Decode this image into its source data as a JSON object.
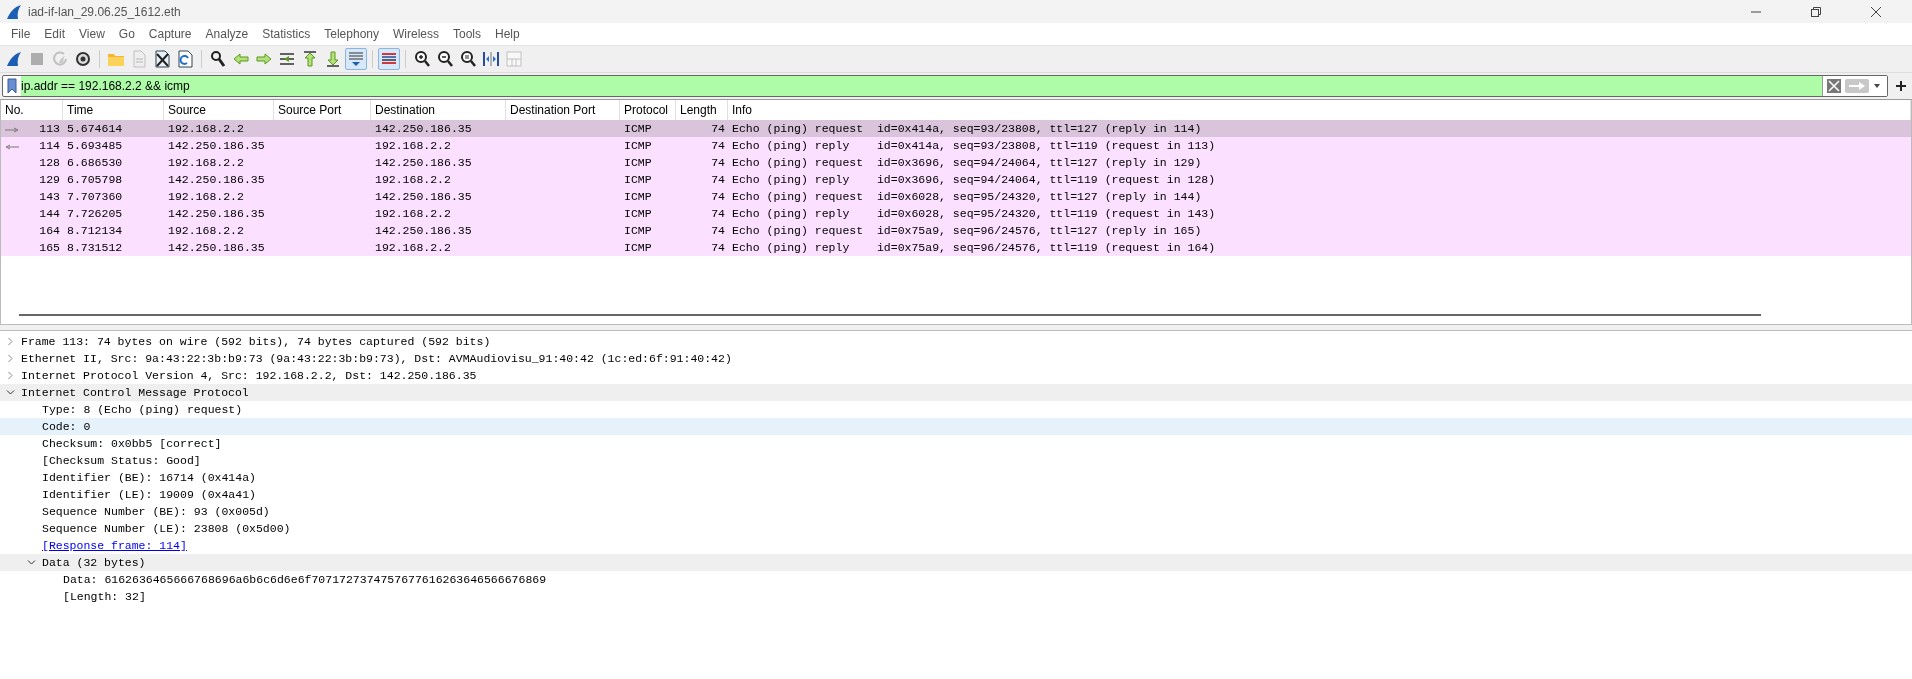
{
  "window": {
    "title": "iad-if-lan_29.06.25_1612.eth"
  },
  "menu": [
    "File",
    "Edit",
    "View",
    "Go",
    "Capture",
    "Analyze",
    "Statistics",
    "Telephony",
    "Wireless",
    "Tools",
    "Help"
  ],
  "toolbar": [
    [
      {
        "kind": "start",
        "on": false,
        "disabled": false
      },
      {
        "kind": "stop",
        "on": false,
        "disabled": true
      },
      {
        "kind": "restart",
        "on": false,
        "disabled": true
      },
      {
        "kind": "options",
        "on": false,
        "disabled": false
      }
    ],
    [
      {
        "kind": "open",
        "on": false,
        "disabled": false
      },
      {
        "kind": "save",
        "on": false,
        "disabled": true
      },
      {
        "kind": "close",
        "on": false,
        "disabled": false
      },
      {
        "kind": "reload",
        "on": false,
        "disabled": false
      }
    ],
    [
      {
        "kind": "find",
        "on": false,
        "disabled": false
      },
      {
        "kind": "back",
        "on": false,
        "disabled": false
      },
      {
        "kind": "forward",
        "on": false,
        "disabled": false
      },
      {
        "kind": "goto",
        "on": false,
        "disabled": false
      },
      {
        "kind": "first",
        "on": false,
        "disabled": false
      },
      {
        "kind": "last",
        "on": false,
        "disabled": false
      },
      {
        "kind": "autoscroll",
        "on": true,
        "disabled": false
      }
    ],
    [
      {
        "kind": "colorize",
        "on": true,
        "disabled": false
      }
    ],
    [
      {
        "kind": "zoomin",
        "on": false,
        "disabled": false
      },
      {
        "kind": "zoomout",
        "on": false,
        "disabled": false
      },
      {
        "kind": "zoomreset",
        "on": false,
        "disabled": false
      },
      {
        "kind": "resize",
        "on": false,
        "disabled": false
      },
      {
        "kind": "layout",
        "on": false,
        "disabled": true
      }
    ]
  ],
  "filter": {
    "value": "ip.addr == 192.168.2.2 && icmp"
  },
  "packet_list": {
    "columns": [
      "No.",
      "Time",
      "Source",
      "Source Port",
      "Destination",
      "Destination Port",
      "Protocol",
      "Length",
      "Info"
    ],
    "rows": [
      {
        "selected": true,
        "kind": "request",
        "cells": [
          "113",
          "5.674614",
          "192.168.2.2",
          "",
          "142.250.186.35",
          "",
          "ICMP",
          "74",
          "Echo (ping) request  id=0x414a, seq=93/23808, ttl=127 (reply in 114)"
        ]
      },
      {
        "selected": false,
        "kind": "reply",
        "cells": [
          "114",
          "5.693485",
          "142.250.186.35",
          "",
          "192.168.2.2",
          "",
          "ICMP",
          "74",
          "Echo (ping) reply    id=0x414a, seq=93/23808, ttl=119 (request in 113)"
        ]
      },
      {
        "selected": false,
        "kind": "plain",
        "cells": [
          "128",
          "6.686530",
          "192.168.2.2",
          "",
          "142.250.186.35",
          "",
          "ICMP",
          "74",
          "Echo (ping) request  id=0x3696, seq=94/24064, ttl=127 (reply in 129)"
        ]
      },
      {
        "selected": false,
        "kind": "plain",
        "cells": [
          "129",
          "6.705798",
          "142.250.186.35",
          "",
          "192.168.2.2",
          "",
          "ICMP",
          "74",
          "Echo (ping) reply    id=0x3696, seq=94/24064, ttl=119 (request in 128)"
        ]
      },
      {
        "selected": false,
        "kind": "plain",
        "cells": [
          "143",
          "7.707360",
          "192.168.2.2",
          "",
          "142.250.186.35",
          "",
          "ICMP",
          "74",
          "Echo (ping) request  id=0x6028, seq=95/24320, ttl=127 (reply in 144)"
        ]
      },
      {
        "selected": false,
        "kind": "plain",
        "cells": [
          "144",
          "7.726205",
          "142.250.186.35",
          "",
          "192.168.2.2",
          "",
          "ICMP",
          "74",
          "Echo (ping) reply    id=0x6028, seq=95/24320, ttl=119 (request in 143)"
        ]
      },
      {
        "selected": false,
        "kind": "plain",
        "cells": [
          "164",
          "8.712134",
          "192.168.2.2",
          "",
          "142.250.186.35",
          "",
          "ICMP",
          "74",
          "Echo (ping) request  id=0x75a9, seq=96/24576, ttl=127 (reply in 165)"
        ]
      },
      {
        "selected": false,
        "kind": "plain",
        "cells": [
          "165",
          "8.731512",
          "142.250.186.35",
          "",
          "192.168.2.2",
          "",
          "ICMP",
          "74",
          "Echo (ping) reply    id=0x75a9, seq=96/24576, ttl=119 (request in 164)"
        ]
      }
    ]
  },
  "packet_details": [
    {
      "kind": "branch",
      "label": "Frame 113: 74 bytes on wire (592 bits), 74 bytes captured (592 bits)",
      "expanded": false,
      "selected": false
    },
    {
      "kind": "branch",
      "label": "Ethernet II, Src: 9a:43:22:3b:b9:73 (9a:43:22:3b:b9:73), Dst: AVMAudiovisu_91:40:42 (1c:ed:6f:91:40:42)",
      "expanded": false,
      "selected": false
    },
    {
      "kind": "branch",
      "label": "Internet Protocol Version 4, Src: 192.168.2.2, Dst: 142.250.186.35",
      "expanded": false,
      "selected": false
    },
    {
      "kind": "branch",
      "label": "Internet Control Message Protocol",
      "expanded": true,
      "selected": false,
      "children": [
        {
          "kind": "leaf",
          "label": "Type: 8 (Echo (ping) request)",
          "selected": false
        },
        {
          "kind": "leaf",
          "label": "Code: 0",
          "selected": true
        },
        {
          "kind": "leaf",
          "label": "Checksum: 0x0bb5 [correct]",
          "selected": false
        },
        {
          "kind": "leaf",
          "label": "[Checksum Status: Good]",
          "selected": false
        },
        {
          "kind": "leaf",
          "label": "Identifier (BE): 16714 (0x414a)",
          "selected": false
        },
        {
          "kind": "leaf",
          "label": "Identifier (LE): 19009 (0x4a41)",
          "selected": false
        },
        {
          "kind": "leaf",
          "label": "Sequence Number (BE): 93 (0x005d)",
          "selected": false
        },
        {
          "kind": "leaf",
          "label": "Sequence Number (LE): 23808 (0x5d00)",
          "selected": false
        },
        {
          "kind": "link",
          "label": "[Response frame: 114]",
          "selected": false
        },
        {
          "kind": "branch",
          "label": "Data (32 bytes)",
          "expanded": true,
          "selected": false,
          "children": [
            {
              "kind": "leaf",
              "label": "Data: 6162636465666768696a6b6c6d6e6f7071727374757677616263646566676869",
              "selected": false
            },
            {
              "kind": "leaf",
              "label": "[Length: 32]",
              "selected": false
            }
          ]
        }
      ]
    }
  ]
}
